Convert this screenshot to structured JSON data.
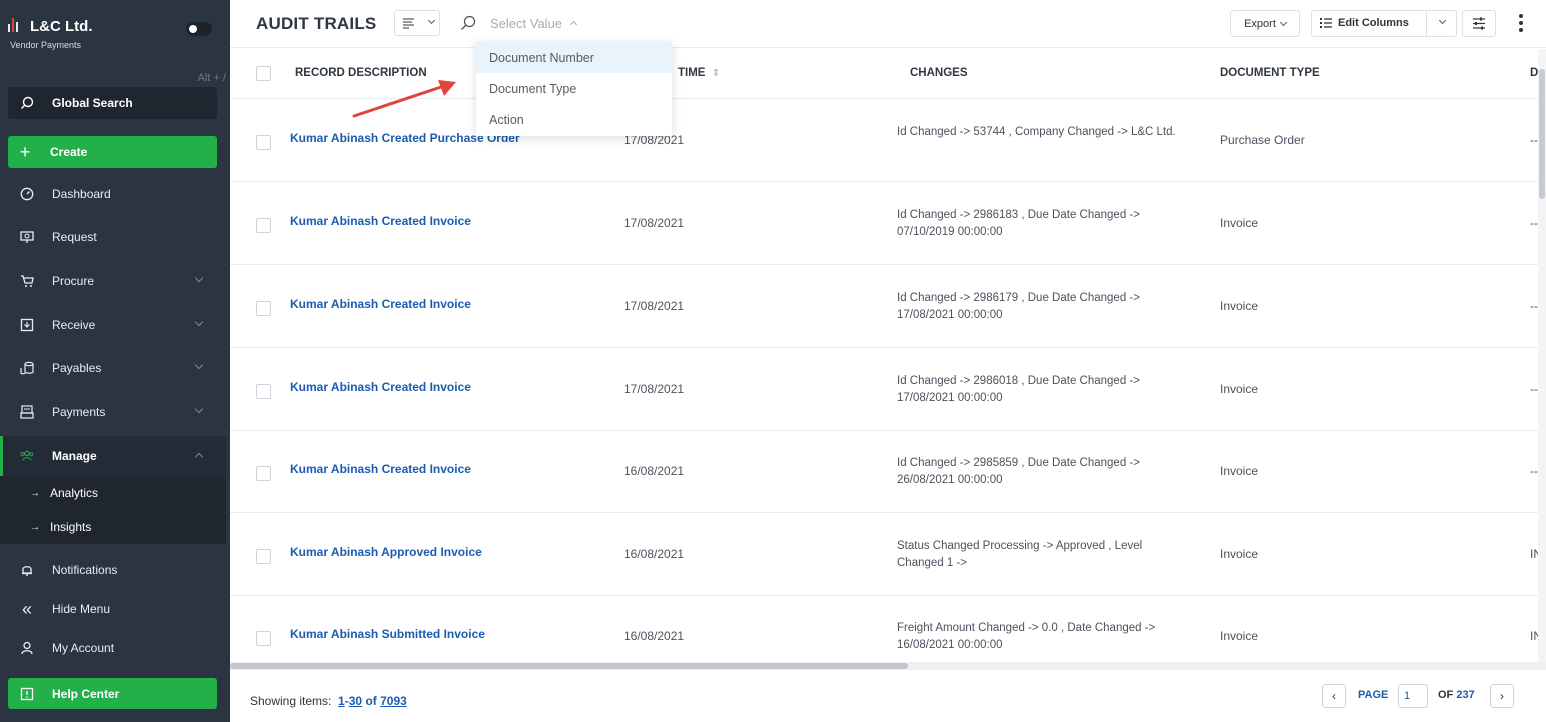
{
  "brand": {
    "title": "L&C Ltd.",
    "subtitle": "Vendor Payments"
  },
  "sidebar": {
    "shortcut_hint": "Alt + /",
    "search_label": "Global Search",
    "create_label": "Create",
    "items": [
      {
        "label": "Dashboard",
        "icon": "dashboard-icon"
      },
      {
        "label": "Request",
        "icon": "request-icon"
      },
      {
        "label": "Procure",
        "icon": "cart-icon"
      },
      {
        "label": "Receive",
        "icon": "receive-icon"
      },
      {
        "label": "Payables",
        "icon": "coins-icon"
      },
      {
        "label": "Payments",
        "icon": "payments-icon"
      },
      {
        "label": "Manage",
        "icon": "users-icon"
      }
    ],
    "sub_items": [
      {
        "label": "Analytics"
      },
      {
        "label": "Insights"
      }
    ],
    "bottom_items": [
      {
        "label": "Notifications",
        "icon": "bell-icon"
      },
      {
        "label": "Hide Menu",
        "icon": "double-chevron-left-icon"
      },
      {
        "label": "My Account",
        "icon": "user-icon"
      }
    ],
    "help_label": "Help Center"
  },
  "toolbar": {
    "page_title": "AUDIT TRAILS",
    "select_placeholder": "Select Value",
    "export_label": "Export",
    "edit_columns_label": "Edit Columns"
  },
  "dropdown": {
    "options": [
      "Document Number",
      "Document Type",
      "Action"
    ],
    "highlighted_index": 0
  },
  "table": {
    "headers": [
      "RECORD DESCRIPTION",
      "TIME",
      "CHANGES",
      "DOCUMENT TYPE",
      "D"
    ],
    "rows": [
      {
        "description": "Kumar Abinash Created Purchase Order",
        "date": "17/08/2021",
        "changes": "Id Changed -> 53744 , Company Changed -> L&C Ltd.",
        "doc_type": "Purchase Order",
        "extra": "--"
      },
      {
        "description": "Kumar Abinash Created Invoice",
        "date": "17/08/2021",
        "changes": "Id Changed -> 2986183 , Due Date Changed -> 07/10/2019 00:00:00",
        "doc_type": "Invoice",
        "extra": "--"
      },
      {
        "description": "Kumar Abinash Created Invoice",
        "date": "17/08/2021",
        "changes": "Id Changed -> 2986179 , Due Date Changed -> 17/08/2021 00:00:00",
        "doc_type": "Invoice",
        "extra": "--"
      },
      {
        "description": "Kumar Abinash Created Invoice",
        "date": "17/08/2021",
        "changes": "Id Changed -> 2986018 , Due Date Changed -> 17/08/2021 00:00:00",
        "doc_type": "Invoice",
        "extra": "--"
      },
      {
        "description": "Kumar Abinash Created Invoice",
        "date": "16/08/2021",
        "changes": "Id Changed -> 2985859 , Due Date Changed -> 26/08/2021 00:00:00",
        "doc_type": "Invoice",
        "extra": "--"
      },
      {
        "description": "Kumar Abinash Approved Invoice",
        "date": "16/08/2021",
        "changes": "Status Changed Processing -> Approved , Level Changed 1 ->",
        "doc_type": "Invoice",
        "extra": "IN"
      },
      {
        "description": "Kumar Abinash Submitted Invoice",
        "date": "16/08/2021",
        "changes": "Freight Amount Changed -> 0.0 , Date Changed -> 16/08/2021 00:00:00",
        "doc_type": "Invoice",
        "extra": "IN"
      }
    ]
  },
  "footer": {
    "showing_label": "Showing items:",
    "range_start": "1",
    "range_sep": "-",
    "range_end": "30",
    "of_label": "of",
    "total": "7093",
    "page_label": "PAGE",
    "page_value": "1",
    "page_of_label": "OF",
    "page_total": "237"
  },
  "colors": {
    "sidebar_bg": "#2b3441",
    "accent_green": "#23b04b",
    "link_blue": "#1a5cb0",
    "annotation_red": "#e0453b"
  }
}
